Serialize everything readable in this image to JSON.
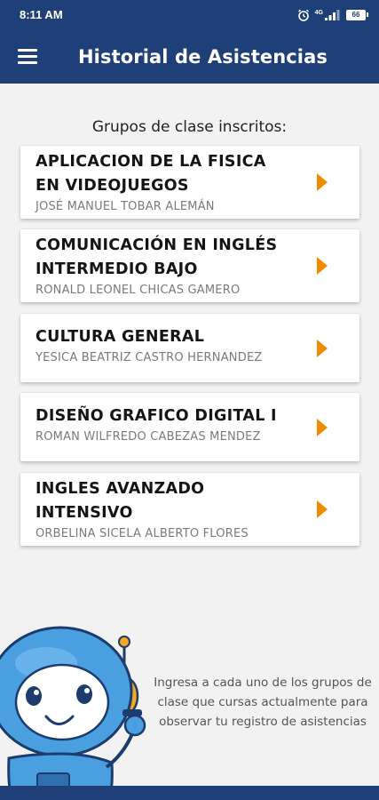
{
  "status": {
    "time": "8:11 AM",
    "network": "4G",
    "battery": "66"
  },
  "appbar": {
    "title": "Historial de Asistencias",
    "menu_icon": "hamburger-icon"
  },
  "section_title": "Grupos de clase inscritos:",
  "groups": [
    {
      "line1": "APLICACION DE LA FISICA",
      "line2": "EN VIDEOJUEGOS",
      "teacher": "JOSÉ MANUEL TOBAR ALEMÁN"
    },
    {
      "line1": "COMUNICACIÓN EN INGLÉS",
      "line2": "INTERMEDIO BAJO",
      "teacher": "RONALD LEONEL CHICAS GAMERO"
    },
    {
      "line1": "CULTURA GENERAL",
      "teacher": "YESICA BEATRIZ CASTRO HERNANDEZ"
    },
    {
      "line1": "DISEÑO GRAFICO DIGITAL I",
      "teacher": "ROMAN WILFREDO CABEZAS MENDEZ"
    },
    {
      "line1": "INGLES AVANZADO",
      "line2": "INTENSIVO",
      "teacher": "ORBELINA SICELA ALBERTO FLORES"
    }
  ],
  "hint": "Ingresa a cada uno de los grupos de clase que cursas actualmente para observar tu registro de asistencias",
  "colors": {
    "primary": "#1f3f78",
    "accent": "#f08a00"
  }
}
